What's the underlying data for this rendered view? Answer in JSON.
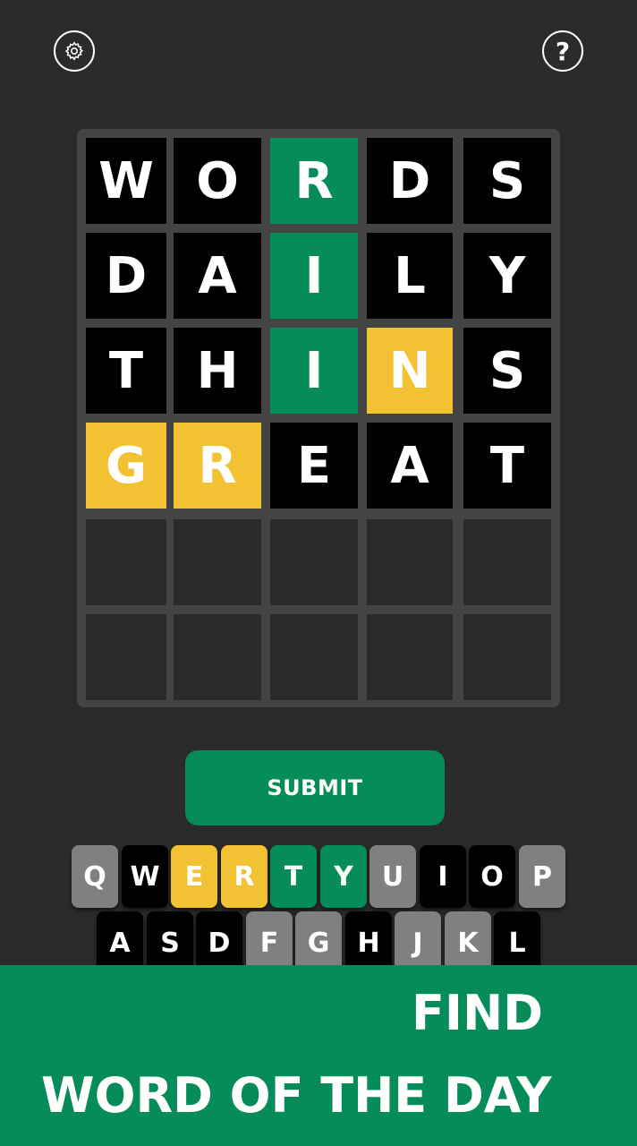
{
  "header": {
    "settings_icon": "gear-icon",
    "help_icon": "question-mark-icon",
    "help_symbol": "?"
  },
  "board": {
    "rows": [
      [
        {
          "letter": "W",
          "state": "absent"
        },
        {
          "letter": "O",
          "state": "absent"
        },
        {
          "letter": "R",
          "state": "correct"
        },
        {
          "letter": "D",
          "state": "absent"
        },
        {
          "letter": "S",
          "state": "absent"
        }
      ],
      [
        {
          "letter": "D",
          "state": "absent"
        },
        {
          "letter": "A",
          "state": "absent"
        },
        {
          "letter": "I",
          "state": "correct"
        },
        {
          "letter": "L",
          "state": "absent"
        },
        {
          "letter": "Y",
          "state": "absent"
        }
      ],
      [
        {
          "letter": "T",
          "state": "absent"
        },
        {
          "letter": "H",
          "state": "absent"
        },
        {
          "letter": "I",
          "state": "correct"
        },
        {
          "letter": "N",
          "state": "present"
        },
        {
          "letter": "S",
          "state": "absent"
        }
      ],
      [
        {
          "letter": "G",
          "state": "present"
        },
        {
          "letter": "R",
          "state": "present"
        },
        {
          "letter": "E",
          "state": "absent"
        },
        {
          "letter": "A",
          "state": "absent"
        },
        {
          "letter": "T",
          "state": "absent"
        }
      ],
      [
        {
          "letter": "",
          "state": "empty"
        },
        {
          "letter": "",
          "state": "empty"
        },
        {
          "letter": "",
          "state": "empty"
        },
        {
          "letter": "",
          "state": "empty"
        },
        {
          "letter": "",
          "state": "empty"
        }
      ],
      [
        {
          "letter": "",
          "state": "empty"
        },
        {
          "letter": "",
          "state": "empty"
        },
        {
          "letter": "",
          "state": "empty"
        },
        {
          "letter": "",
          "state": "empty"
        },
        {
          "letter": "",
          "state": "empty"
        }
      ]
    ]
  },
  "submit_label": "SUBMIT",
  "keyboard": {
    "rows": [
      [
        {
          "k": "Q",
          "state": "unused"
        },
        {
          "k": "W",
          "state": "absent"
        },
        {
          "k": "E",
          "state": "present"
        },
        {
          "k": "R",
          "state": "present"
        },
        {
          "k": "T",
          "state": "correct"
        },
        {
          "k": "Y",
          "state": "correct"
        },
        {
          "k": "U",
          "state": "unused"
        },
        {
          "k": "I",
          "state": "absent"
        },
        {
          "k": "O",
          "state": "absent"
        },
        {
          "k": "P",
          "state": "unused"
        }
      ],
      [
        {
          "k": "A",
          "state": "absent"
        },
        {
          "k": "S",
          "state": "absent"
        },
        {
          "k": "D",
          "state": "absent"
        },
        {
          "k": "F",
          "state": "unused"
        },
        {
          "k": "G",
          "state": "unused"
        },
        {
          "k": "H",
          "state": "absent"
        },
        {
          "k": "J",
          "state": "unused"
        },
        {
          "k": "K",
          "state": "unused"
        },
        {
          "k": "L",
          "state": "absent"
        }
      ]
    ]
  },
  "banner": {
    "line1": "FIND",
    "line2": "WORD OF THE DAY"
  },
  "colors": {
    "background": "#2b2b2b",
    "board": "#444444",
    "correct": "#058c58",
    "present": "#f2c232",
    "absent": "#000000",
    "empty": "#2b2b2b",
    "unused": "#808080",
    "accent": "#058c58"
  }
}
